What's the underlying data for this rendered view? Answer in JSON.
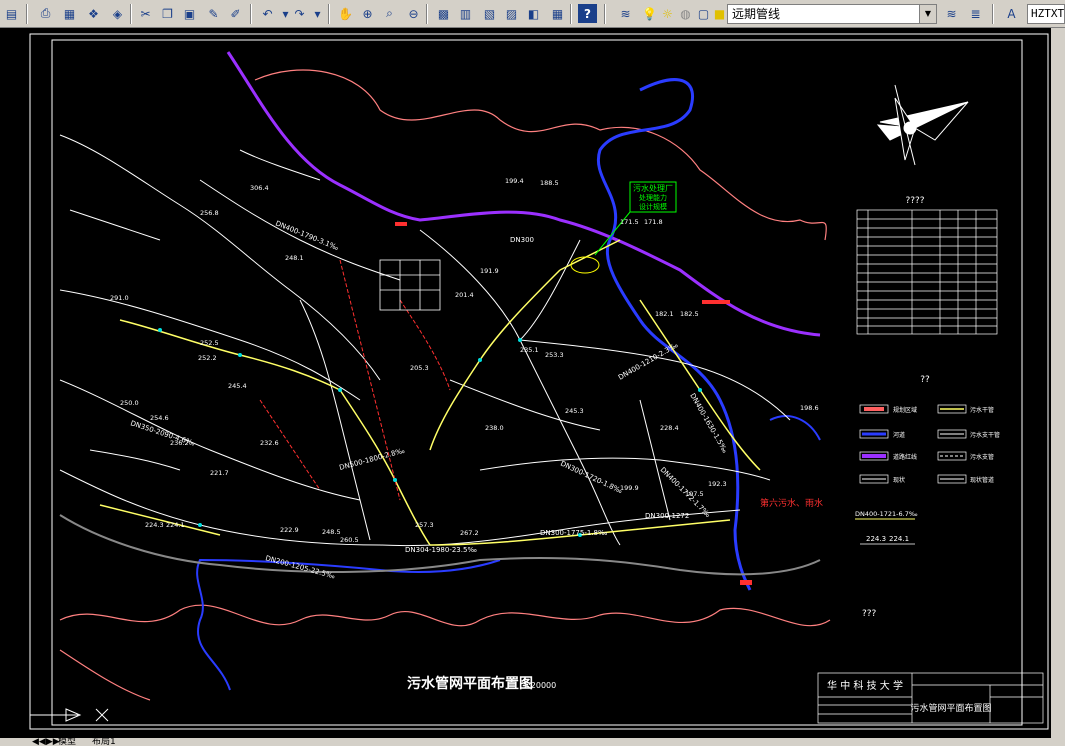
{
  "toolbar": {
    "icons": [
      "save-icon",
      "print-icon",
      "plot-preview-icon",
      "publish-icon",
      "cut-icon",
      "copy-icon",
      "paste-icon",
      "match-properties-icon",
      "undo-icon",
      "redo-icon",
      "pan-icon",
      "zoom-realtime-icon",
      "zoom-window-icon",
      "zoom-previous-icon",
      "properties-icon",
      "design-center-icon",
      "tool-palettes-icon",
      "calculator-icon",
      "help-icon",
      "layer-manager-icon",
      "lightbulb-icon",
      "layer-state-icon",
      "make-current-icon",
      "match-layer-icon",
      "text-style-icon"
    ],
    "layer_current": "远期管线",
    "text_style": "HZTXT"
  },
  "drawing": {
    "title": "污水管网平面布置图",
    "scale": "1:20000",
    "table_title": "????",
    "legend_title": "??",
    "notes_title": "???",
    "plant_label_lines": [
      "污水处理厂",
      "处理能力",
      "设计规模"
    ],
    "university": "华 中 科 技 大 学",
    "titleblock_drawing": "污水管网平面布置图",
    "district_label": "第六污水、雨水",
    "legend_items": [
      {
        "label": "规划区域",
        "color": "#ff6060"
      },
      {
        "label": "河道",
        "color": "#2a3cff"
      },
      {
        "label": "道路红线",
        "color": "#9b30ff"
      },
      {
        "label": "现状",
        "color": "#ffffff"
      },
      {
        "label": "污水干管",
        "color": "#ffff66"
      },
      {
        "label": "污水支干管",
        "color": "#ffffff"
      },
      {
        "label": "污水支管",
        "color": "#ffffff"
      },
      {
        "label": "现状管道",
        "color": "#ffffff"
      }
    ],
    "pipe_labels": [
      {
        "text": "DN400-1721-6.7‰"
      },
      {
        "text": "224.3"
      },
      {
        "text": "224.1"
      },
      {
        "text": "DN300"
      },
      {
        "text": "DN400-1790-3.1‰"
      },
      {
        "text": "DN350-2090-4.6‰"
      },
      {
        "text": "DN300-1720-1.8‰"
      },
      {
        "text": "DN400-1210-2.3‰"
      },
      {
        "text": "DN300-1775-1.8‰"
      },
      {
        "text": "DN300-1272"
      },
      {
        "text": "DN304-1980-23.5‰"
      },
      {
        "text": "DN200-1205-22.5‰"
      },
      {
        "text": "DN400-1772-1.7‰"
      },
      {
        "text": "DN500-1800-2.8‰"
      },
      {
        "text": "DN400-1630-1.5‰"
      }
    ],
    "elevations": [
      "199.4",
      "188.5",
      "171.5",
      "171.8",
      "182.1",
      "182.5",
      "256.8",
      "306.4",
      "291.0",
      "252.5",
      "252.2",
      "250.0",
      "254.6",
      "236.2",
      "221.7",
      "232.6",
      "224.3",
      "224.1",
      "222.9",
      "248.5",
      "260.5",
      "257.3",
      "267.2",
      "253.3",
      "235.1",
      "245.3",
      "238.0",
      "228.4",
      "199.9",
      "198.6",
      "197.5",
      "192.3",
      "191.9",
      "201.4",
      "205.3",
      "248.1",
      "245.4"
    ]
  },
  "tabs": {
    "model": "模型",
    "layout": "布局1"
  }
}
